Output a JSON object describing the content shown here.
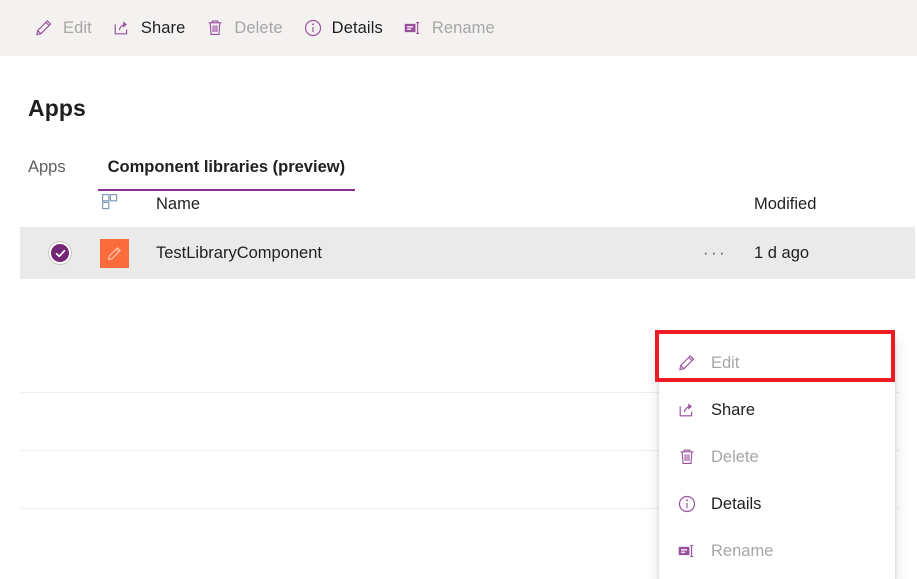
{
  "commandbar": {
    "items": [
      {
        "icon": "pencil-icon",
        "label": "Edit",
        "enabled": false
      },
      {
        "icon": "share-icon",
        "label": "Share",
        "enabled": true
      },
      {
        "icon": "trash-icon",
        "label": "Delete",
        "enabled": false
      },
      {
        "icon": "info-icon",
        "label": "Details",
        "enabled": true
      },
      {
        "icon": "rename-icon",
        "label": "Rename",
        "enabled": false
      }
    ]
  },
  "page": {
    "title": "Apps"
  },
  "tabs": [
    {
      "label": "Apps",
      "active": false
    },
    {
      "label": "Component libraries (preview)",
      "active": true
    }
  ],
  "list": {
    "columns": {
      "type_icon": "component-grid-icon",
      "name": "Name",
      "modified": "Modified"
    },
    "rows": [
      {
        "selected": true,
        "select_icon": "checkmark-circle-icon",
        "app_icon": "orange-pencil-tile-icon",
        "name": "TestLibraryComponent",
        "overflow_icon": "ellipsis-icon",
        "overflow_label": "···",
        "modified": "1 d ago"
      }
    ]
  },
  "context_menu": {
    "items": [
      {
        "icon": "pencil-icon",
        "label": "Edit",
        "enabled": false,
        "highlighted": true
      },
      {
        "icon": "share-icon",
        "label": "Share",
        "enabled": true,
        "highlighted": false
      },
      {
        "icon": "trash-icon",
        "label": "Delete",
        "enabled": false,
        "highlighted": false
      },
      {
        "icon": "info-icon",
        "label": "Details",
        "enabled": true,
        "highlighted": false
      },
      {
        "icon": "rename-icon",
        "label": "Rename",
        "enabled": false,
        "highlighted": false
      }
    ]
  },
  "annotation": {
    "type": "red-highlight-box",
    "target": "Edit",
    "color": "#ed1c24"
  },
  "colors": {
    "accent_purple": "#8a2e8e",
    "icon_purple": "#9b4f9e",
    "check_purple": "#742774",
    "app_tile_orange": "#fa6c3c",
    "commandbar_bg": "#f3f2f1",
    "row_selected_bg": "#ebeaea",
    "text_enabled": "#201f1e",
    "text_disabled": "#a8a6a4",
    "annotation_red": "#ed1c24"
  }
}
